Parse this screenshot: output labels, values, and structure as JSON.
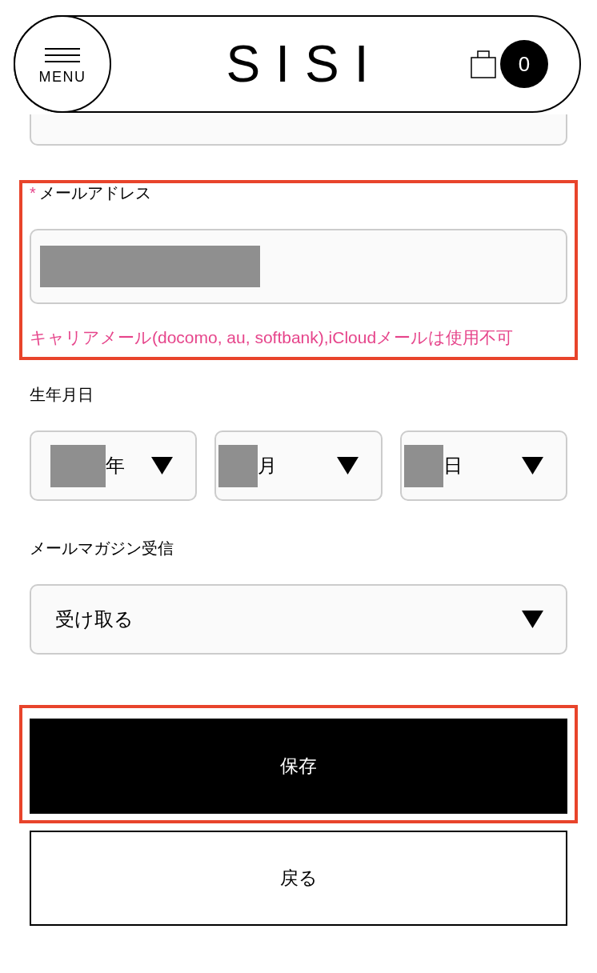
{
  "header": {
    "menu_label": "MENU",
    "logo": "SISI",
    "cart_count": "0"
  },
  "fields": [
    {
      "kind": "text_cut_off",
      "highlighted": false
    },
    {
      "kind": "text",
      "required_mark": "*",
      "label": "メールアドレス",
      "redacted": true,
      "note": "キャリアメール(docomo, au, softbank),iCloudメールは使用不可",
      "highlighted": true
    },
    {
      "kind": "date",
      "label": "生年月日",
      "highlighted": false,
      "parts": [
        {
          "unit": "年",
          "redacted": true
        },
        {
          "unit": "月",
          "redacted": true
        },
        {
          "unit": "日",
          "redacted": true
        }
      ]
    },
    {
      "kind": "select",
      "label": "メールマガジン受信",
      "value": "受け取る",
      "highlighted": false
    }
  ],
  "buttons": [
    {
      "kind": "submit",
      "label": "保存",
      "highlighted": true
    },
    {
      "kind": "back",
      "label": "戻る",
      "highlighted": false
    }
  ]
}
